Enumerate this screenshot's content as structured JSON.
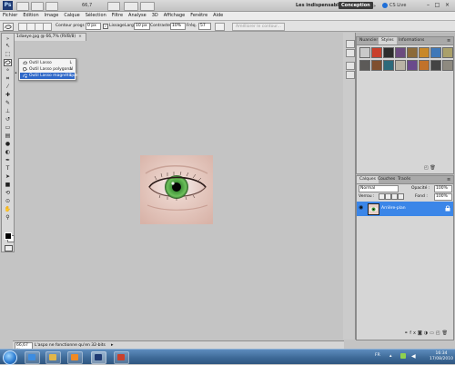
{
  "appbar": {
    "zoom": "66,7",
    "workspaces": [
      "Les indispensables",
      "Conception"
    ],
    "active_workspace": "Conception",
    "cs_live": "CS Live"
  },
  "menubar": {
    "items": [
      "Fichier",
      "Edition",
      "Image",
      "Calque",
      "Sélection",
      "Filtre",
      "Analyse",
      "3D",
      "Affichage",
      "Fenêtre",
      "Aide"
    ]
  },
  "options": {
    "contour_label": "Contour progr. :",
    "contour_value": "0 px",
    "lissage_label": "Lissage",
    "largeur_label": "Larg. :",
    "largeur_value": "10 px",
    "contraste_label": "Contraste :",
    "contraste_value": "10%",
    "frequence_label": "Fréq. :",
    "frequence_value": "57",
    "ameliorer_label": "Améliorer le contour..."
  },
  "document": {
    "tab_title": "1daeye.jpg @ 66,7% (RVB/8)",
    "close_symbol": "×",
    "zoom_field": "66,67 %",
    "status_text": "L'aspo ne fonctionne qu'en 32-bits"
  },
  "tool_flyout": {
    "items": [
      {
        "label": "Outil Lasso",
        "shortcut": "L"
      },
      {
        "label": "Outil Lasso polygonal",
        "shortcut": "L"
      },
      {
        "label": "Outil Lasso magnétique",
        "shortcut": "L"
      }
    ],
    "active_index": 2
  },
  "panels": {
    "top_tabs": [
      "Nuancier",
      "Styles",
      "Informations"
    ],
    "top_active": "Styles",
    "style_colors": [
      "#c9c9c9",
      "#c9402c",
      "#2d2d2d",
      "#6b4b7e",
      "#8c6b3a",
      "#c88828",
      "#3f78b8",
      "#aaa06a",
      "#5c5a58",
      "#7f4f2f",
      "#2d6a7a",
      "#b9b4a6",
      "#6a4a8c",
      "#c1722b",
      "#444444",
      "#8e8a80"
    ],
    "layers_tabs": [
      "Calques",
      "Couches",
      "Tracés"
    ],
    "layers_active": "Calques",
    "blend_mode": "Normal",
    "opacity_label": "Opacité :",
    "opacity_value": "100%",
    "lock_label": "Verrou :",
    "fill_label": "Fond :",
    "fill_value": "100%",
    "layer_name": "Arrière-plan"
  },
  "taskbar": {
    "tray_lang": "FR",
    "time": "16:34",
    "date": "17/08/2010"
  },
  "colors": {
    "selection_blue": "#3b86e8",
    "canvas_bg": "#c4c4c4",
    "iris_green": "#3f9b3a"
  }
}
